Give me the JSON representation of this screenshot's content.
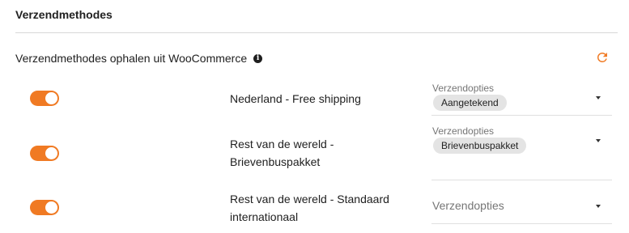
{
  "section": {
    "title": "Verzendmethodes"
  },
  "fetch": {
    "label": "Verzendmethodes ophalen uit WooCommerce",
    "info_icon": "i",
    "refresh_icon": "refresh-icon"
  },
  "colors": {
    "accent": "#f07a23"
  },
  "methods": [
    {
      "name": "Nederland - Free shipping",
      "enabled": true,
      "select_label": "Verzendopties",
      "chip": "Aangetekend"
    },
    {
      "name": "Rest van de wereld - Brievenbuspakket",
      "enabled": true,
      "select_label": "Verzendopties",
      "chip": "Brievenbuspakket"
    },
    {
      "name": "Rest van de wereld - Standaard internationaal",
      "enabled": true,
      "select_label": "Verzendopties",
      "chip": ""
    }
  ]
}
